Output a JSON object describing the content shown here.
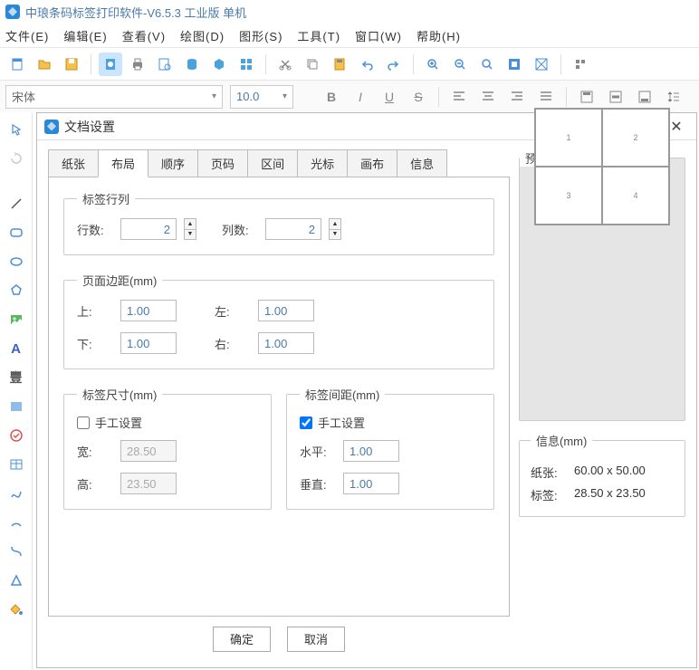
{
  "titlebar": {
    "text": "中琅条码标签打印软件-V6.5.3 工业版 单机"
  },
  "menu": {
    "file": "文件(E)",
    "edit": "编辑(E)",
    "view": "查看(V)",
    "draw": "绘图(D)",
    "graphics": "图形(S)",
    "tools": "工具(T)",
    "window": "窗口(W)",
    "help": "帮助(H)"
  },
  "font": {
    "family": "宋体",
    "size": "10.0"
  },
  "dialog": {
    "title": "文档设置",
    "tabs": [
      "纸张",
      "布局",
      "顺序",
      "页码",
      "区间",
      "光标",
      "画布",
      "信息"
    ],
    "active_tab": "布局",
    "layout": {
      "rowcol_legend": "标签行列",
      "rows_label": "行数:",
      "rows": "2",
      "cols_label": "列数:",
      "cols": "2",
      "margin_legend": "页面边距(mm)",
      "top_label": "上:",
      "top": "1.00",
      "left_label": "左:",
      "left": "1.00",
      "bottom_label": "下:",
      "bottom": "1.00",
      "right_label": "右:",
      "right": "1.00",
      "size_legend": "标签尺寸(mm)",
      "manual_label": "手工设置",
      "size_manual_checked": false,
      "w_label": "宽:",
      "w": "28.50",
      "h_label": "高:",
      "h": "23.50",
      "gap_legend": "标签间距(mm)",
      "gap_manual_checked": true,
      "hg_label": "水平:",
      "hg": "1.00",
      "vg_label": "垂直:",
      "vg": "1.00"
    },
    "preview_legend": "预览",
    "info": {
      "legend": "信息(mm)",
      "paper_label": "纸张:",
      "paper": "60.00 x 50.00",
      "label_label": "标签:",
      "label": "28.50 x 23.50"
    },
    "ok": "确定",
    "cancel": "取消"
  }
}
